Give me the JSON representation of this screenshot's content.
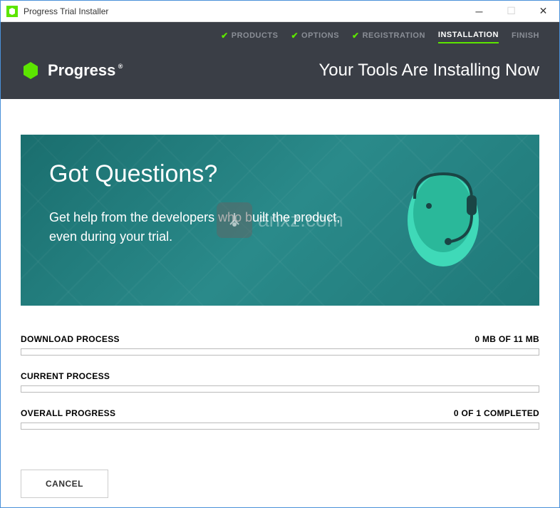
{
  "titlebar": {
    "title": "Progress Trial Installer"
  },
  "header": {
    "steps": [
      {
        "label": "PRODUCTS",
        "done": true
      },
      {
        "label": "OPTIONS",
        "done": true
      },
      {
        "label": "REGISTRATION",
        "done": true
      },
      {
        "label": "INSTALLATION",
        "active": true
      },
      {
        "label": "FINISH"
      }
    ],
    "brand": "Progress",
    "title": "Your Tools Are Installing Now"
  },
  "banner": {
    "title": "Got Questions?",
    "text": "Get help from the developers who built the product, even during your trial."
  },
  "watermark": {
    "text": "anxz.com"
  },
  "progress": {
    "download": {
      "label": "DOWNLOAD PROCESS",
      "status": "0 MB OF 11 MB"
    },
    "current": {
      "label": "CURRENT PROCESS",
      "status": ""
    },
    "overall": {
      "label": "OVERALL PROGRESS",
      "status": "0 OF 1 COMPLETED"
    }
  },
  "footer": {
    "cancel_label": "CANCEL"
  }
}
